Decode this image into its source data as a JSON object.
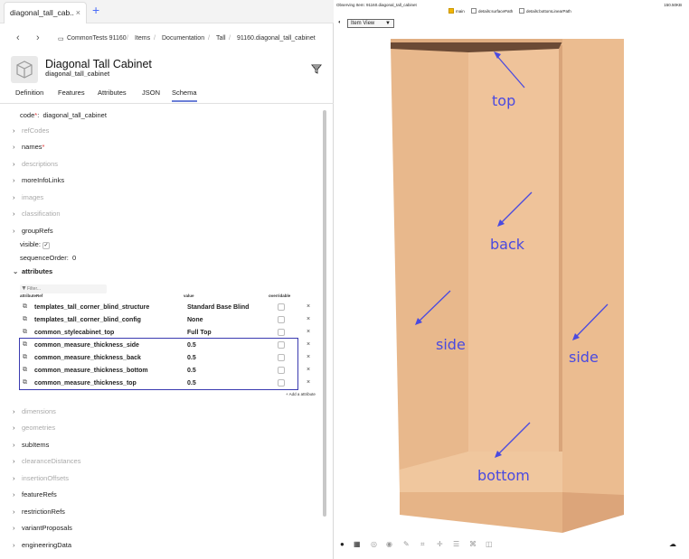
{
  "left_panel": {
    "tab": {
      "label": "diagonal_tall_cab..",
      "close": "×",
      "add": "+"
    },
    "breadcrumb": [
      "CommonTests 91160",
      "Items",
      "Documentation",
      "Tall",
      "91160.diagonal_tall_cabinet"
    ],
    "breadcrumb_sep": "/",
    "header": {
      "title": "Diagonal Tall Cabinet",
      "subtitle": "diagonal_tall_cabinet"
    },
    "tabs": [
      "Definition",
      "Features",
      "Attributes",
      "JSON",
      "Schema"
    ],
    "active_tab": "Schema",
    "tree": {
      "code_label": "code",
      "code_value": "diagonal_tall_cabinet",
      "refCodes": "refCodes",
      "names": "names",
      "descriptions": "descriptions",
      "moreInfoLinks": "moreInfoLinks",
      "images": "images",
      "classification": "classification",
      "groupRefs": "groupRefs",
      "visible": "visible:",
      "sequenceOrder": "sequenceOrder:",
      "sequenceOrder_value": "0",
      "attributes": "attributes",
      "dimensions": "dimensions",
      "geometries": "geometries",
      "subItems": "subItems",
      "clearanceDistances": "clearanceDistances",
      "insertionOffsets": "insertionOffsets",
      "featureRefs": "featureRefs",
      "restrictionRefs": "restrictionRefs",
      "variantProposals": "variantProposals",
      "engineeringData": "engineeringData"
    },
    "attributes_table": {
      "filter_placeholder": "Filter...",
      "headers": [
        "attributeRef",
        "value",
        "overridable"
      ],
      "rows": [
        {
          "ref": "templates_tall_corner_blind_structure",
          "value": "Standard Base Blind"
        },
        {
          "ref": "templates_tall_corner_blind_config",
          "value": "None"
        },
        {
          "ref": "common_stylecabinet_top",
          "value": "Full Top"
        },
        {
          "ref": "common_measure_thickness_side",
          "value": "0.5"
        },
        {
          "ref": "common_measure_thickness_back",
          "value": "0.5"
        },
        {
          "ref": "common_measure_thickness_bottom",
          "value": "0.5"
        },
        {
          "ref": "common_measure_thickness_top",
          "value": "0.5"
        }
      ],
      "remove": "×",
      "add_label": "+ Add a attribute"
    }
  },
  "right_panel": {
    "observing": "Observing Item: 91160.diagonal_tall_cabinet",
    "checkboxes": [
      {
        "label": "main",
        "checked": true
      },
      {
        "label": "details:surfacePath",
        "checked": false
      },
      {
        "label": "details:bottomLinearPath",
        "checked": false
      }
    ],
    "size": "150.50KB",
    "view_select": "Item View",
    "annotations": [
      "top",
      "back",
      "side",
      "side",
      "bottom"
    ],
    "annotation_color": "#4a4ae0",
    "wood_color": "#e9b98d"
  }
}
